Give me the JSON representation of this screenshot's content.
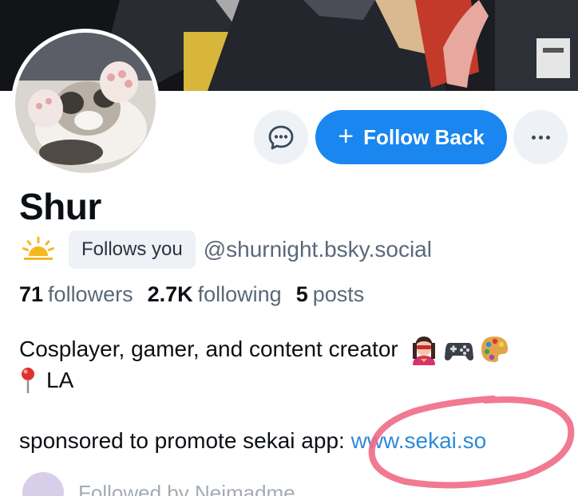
{
  "profile": {
    "display_name": "Shur",
    "follows_you_badge": "Follows you",
    "handle": "@shurnight.bsky.social"
  },
  "actions": {
    "follow_back_label": "Follow Back",
    "follow_back_plus": "+"
  },
  "stats": {
    "followers_count": "71",
    "followers_label": "followers",
    "following_count": "2.7K",
    "following_label": "following",
    "posts_count": "5",
    "posts_label": "posts"
  },
  "bio": {
    "line1": "Cosplayer, gamer, and content creator",
    "line2": "LA",
    "sponsor_text": "sponsored to promote sekai app: ",
    "sponsor_link": "www.sekai.so"
  },
  "followed_by": {
    "text": "Followed by Neimadme..."
  },
  "colors": {
    "follow_button": "#1a86f0",
    "link": "#2f8ad6",
    "highlight_circle": "#f06a86"
  },
  "icons": [
    "message-icon",
    "plus-icon",
    "more-dots-icon",
    "sun-icon",
    "superhero-emoji",
    "gamepad-emoji",
    "palette-emoji",
    "pin-emoji"
  ]
}
